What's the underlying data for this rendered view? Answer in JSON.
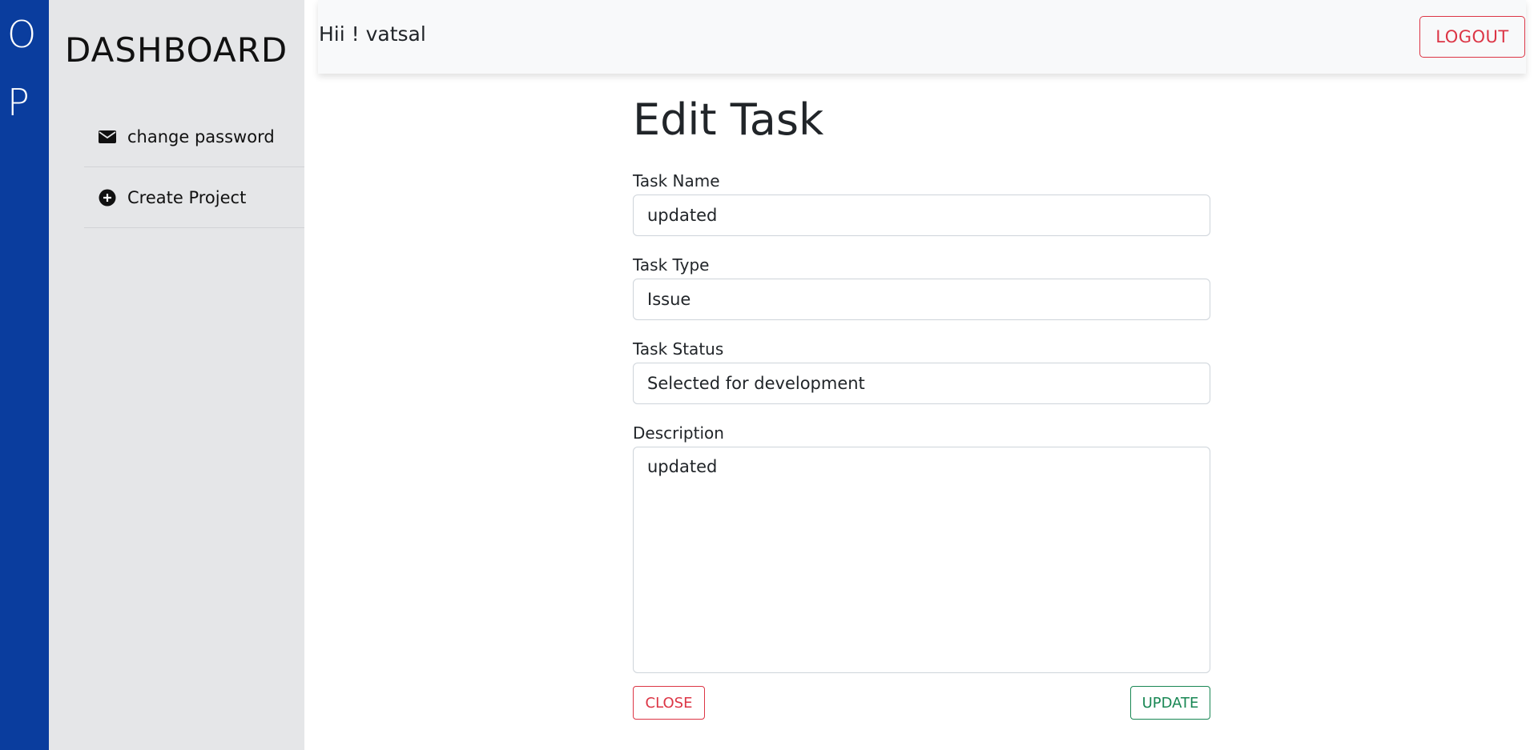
{
  "brand_bar": {
    "letters": [
      "O",
      "P"
    ]
  },
  "sidebar": {
    "title": "DASHBOARD",
    "items": [
      {
        "label": "change password",
        "icon": "envelope-icon"
      },
      {
        "label": "Create Project",
        "icon": "plus-circle-icon"
      }
    ]
  },
  "header": {
    "greeting": "Hii ! vatsal",
    "logout_label": "LOGOUT"
  },
  "form": {
    "title": "Edit Task",
    "task_name": {
      "label": "Task Name",
      "value": "updated"
    },
    "task_type": {
      "label": "Task Type",
      "value": "Issue"
    },
    "task_status": {
      "label": "Task Status",
      "value": "Selected for development"
    },
    "description": {
      "label": "Description",
      "value": "updated"
    },
    "close_label": "CLOSE",
    "update_label": "UPDATE"
  },
  "colors": {
    "brand_blue": "#0a3d9e",
    "sidebar_bg": "#e5e6e8",
    "danger": "#dc3545",
    "success": "#198754"
  }
}
